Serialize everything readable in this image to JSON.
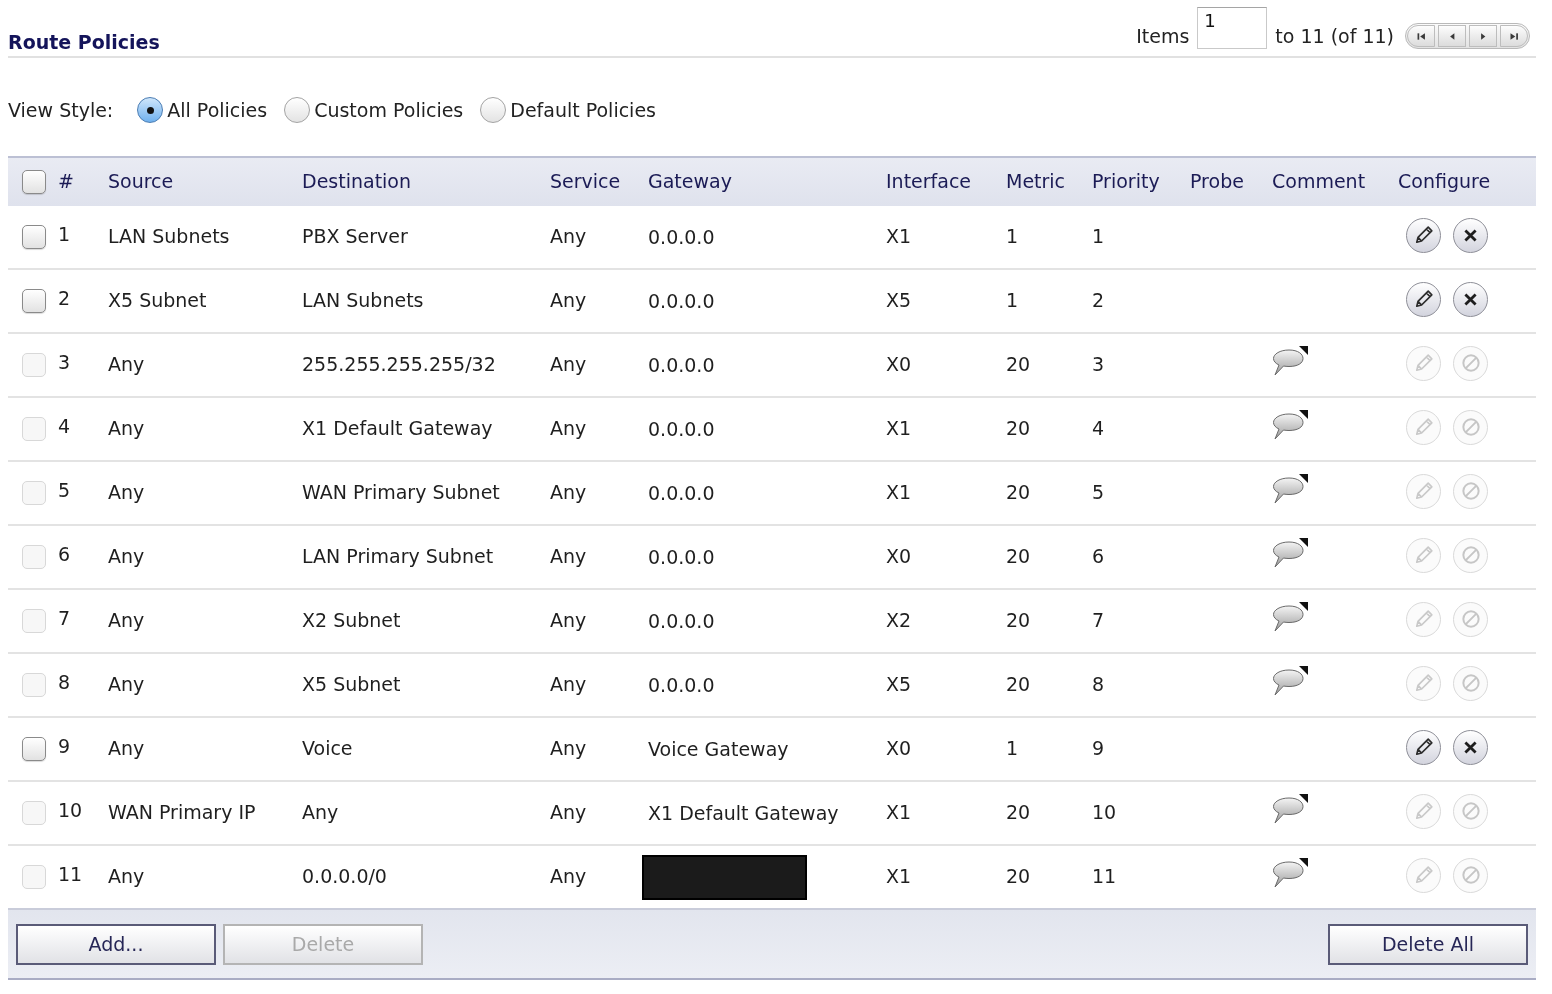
{
  "title": "Route Policies",
  "pager": {
    "label": "Items",
    "start": "1",
    "range": "to 11 (of 11)"
  },
  "view_style": {
    "label": "View Style:",
    "options": [
      {
        "label": "All Policies",
        "selected": true
      },
      {
        "label": "Custom Policies",
        "selected": false
      },
      {
        "label": "Default Policies",
        "selected": false
      }
    ]
  },
  "table": {
    "select_all_checked": false,
    "columns": [
      "#",
      "Source",
      "Destination",
      "Service",
      "Gateway",
      "Interface",
      "Metric",
      "Priority",
      "Probe",
      "Comment",
      "Configure"
    ],
    "rows": [
      {
        "number": "1",
        "source": "LAN Subnets",
        "destination": "PBX Server",
        "service": "Any",
        "gateway": "0.0.0.0",
        "gateway_redacted": false,
        "interface": "X1",
        "metric": "1",
        "priority": "1",
        "has_comment": false,
        "checked": false,
        "disabled": false
      },
      {
        "number": "2",
        "source": "X5 Subnet",
        "destination": "LAN Subnets",
        "service": "Any",
        "gateway": "0.0.0.0",
        "gateway_redacted": false,
        "interface": "X5",
        "metric": "1",
        "priority": "2",
        "has_comment": false,
        "checked": false,
        "disabled": false
      },
      {
        "number": "3",
        "source": "Any",
        "destination": "255.255.255.255/32",
        "service": "Any",
        "gateway": "0.0.0.0",
        "gateway_redacted": false,
        "interface": "X0",
        "metric": "20",
        "priority": "3",
        "has_comment": true,
        "checked": false,
        "disabled": true
      },
      {
        "number": "4",
        "source": "Any",
        "destination": "X1 Default Gateway",
        "service": "Any",
        "gateway": "0.0.0.0",
        "gateway_redacted": false,
        "interface": "X1",
        "metric": "20",
        "priority": "4",
        "has_comment": true,
        "checked": false,
        "disabled": true
      },
      {
        "number": "5",
        "source": "Any",
        "destination": "WAN Primary Subnet",
        "service": "Any",
        "gateway": "0.0.0.0",
        "gateway_redacted": false,
        "interface": "X1",
        "metric": "20",
        "priority": "5",
        "has_comment": true,
        "checked": false,
        "disabled": true
      },
      {
        "number": "6",
        "source": "Any",
        "destination": "LAN Primary Subnet",
        "service": "Any",
        "gateway": "0.0.0.0",
        "gateway_redacted": false,
        "interface": "X0",
        "metric": "20",
        "priority": "6",
        "has_comment": true,
        "checked": false,
        "disabled": true
      },
      {
        "number": "7",
        "source": "Any",
        "destination": "X2 Subnet",
        "service": "Any",
        "gateway": "0.0.0.0",
        "gateway_redacted": false,
        "interface": "X2",
        "metric": "20",
        "priority": "7",
        "has_comment": true,
        "checked": false,
        "disabled": true
      },
      {
        "number": "8",
        "source": "Any",
        "destination": "X5 Subnet",
        "service": "Any",
        "gateway": "0.0.0.0",
        "gateway_redacted": false,
        "interface": "X5",
        "metric": "20",
        "priority": "8",
        "has_comment": true,
        "checked": false,
        "disabled": true
      },
      {
        "number": "9",
        "source": "Any",
        "destination": "Voice",
        "service": "Any",
        "gateway": "Voice Gateway",
        "gateway_redacted": false,
        "interface": "X0",
        "metric": "1",
        "priority": "9",
        "has_comment": false,
        "checked": false,
        "disabled": false
      },
      {
        "number": "10",
        "source": "WAN Primary IP",
        "destination": "Any",
        "service": "Any",
        "gateway": "X1 Default Gateway",
        "gateway_redacted": false,
        "interface": "X1",
        "metric": "20",
        "priority": "10",
        "has_comment": true,
        "checked": false,
        "disabled": true
      },
      {
        "number": "11",
        "source": "Any",
        "destination": "0.0.0.0/0",
        "service": "Any",
        "gateway_redacted": true,
        "interface": "X1",
        "metric": "20",
        "priority": "11",
        "has_comment": true,
        "checked": false,
        "disabled": true
      }
    ]
  },
  "footer": {
    "left_buttons": [
      {
        "label": "Add...",
        "disabled": false
      },
      {
        "label": "Delete",
        "disabled": true
      }
    ],
    "right_buttons": [
      {
        "label": "Delete All",
        "disabled": false
      }
    ]
  }
}
